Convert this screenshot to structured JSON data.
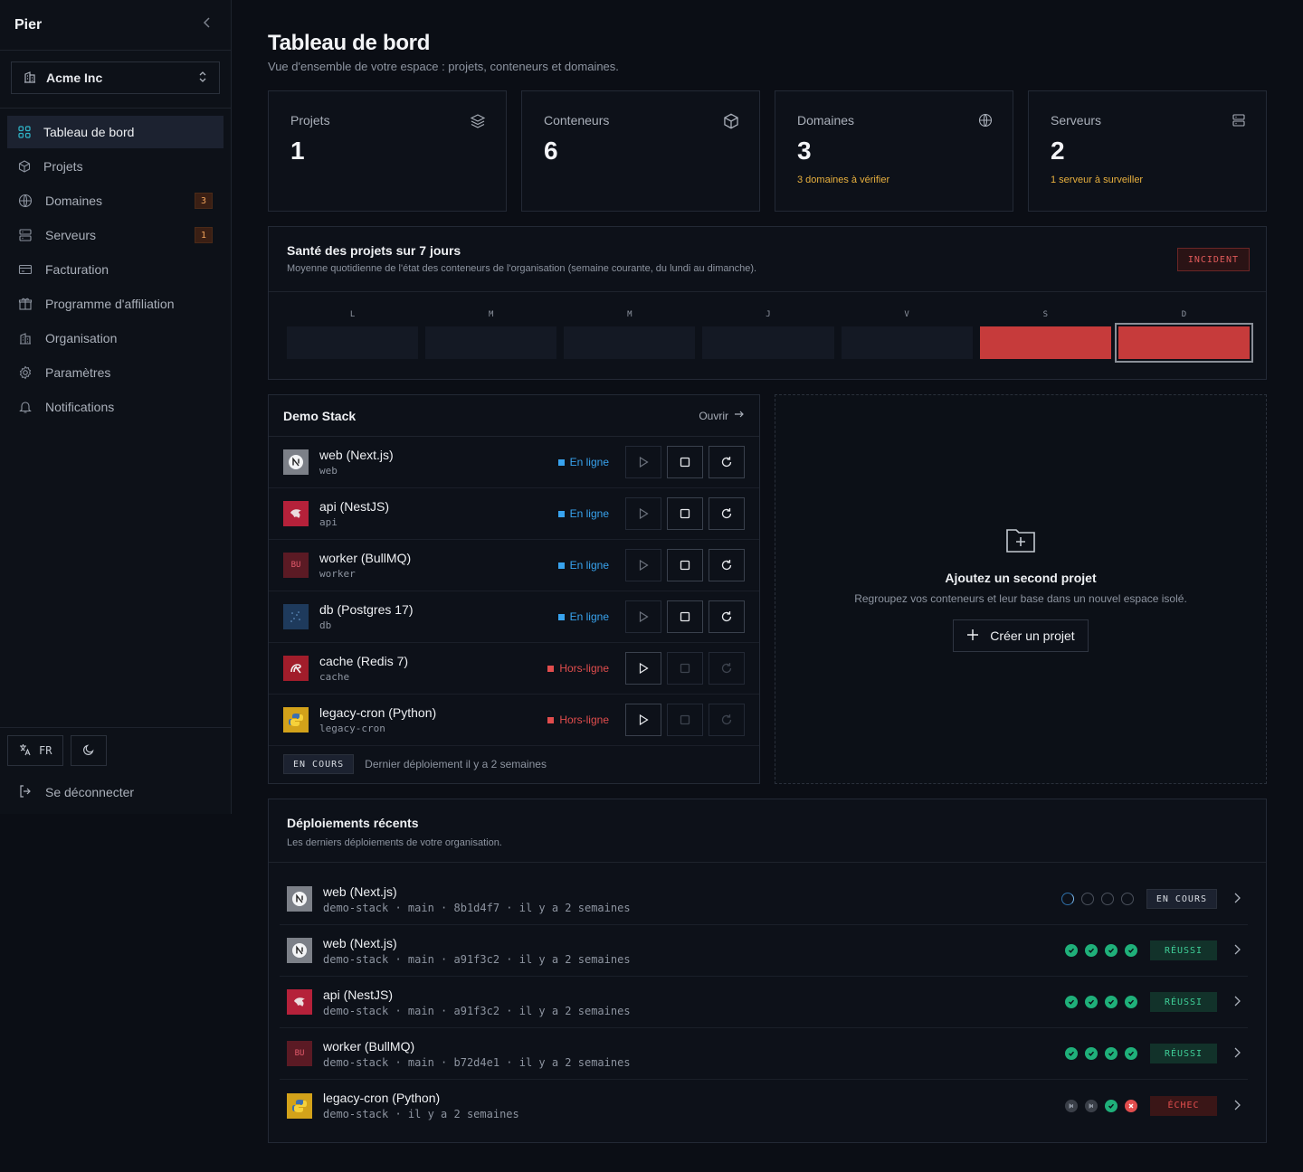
{
  "app": {
    "brand": "Pier"
  },
  "org": {
    "name": "Acme Inc"
  },
  "nav": {
    "items": [
      {
        "label": "Tableau de bord",
        "icon": "grid-icon",
        "active": true,
        "badge": ""
      },
      {
        "label": "Projets",
        "icon": "box-icon",
        "badge": ""
      },
      {
        "label": "Domaines",
        "icon": "globe-icon",
        "badge": "3"
      },
      {
        "label": "Serveurs",
        "icon": "server-icon",
        "badge": "1"
      },
      {
        "label": "Facturation",
        "icon": "card-icon",
        "badge": ""
      },
      {
        "label": "Programme d'affiliation",
        "icon": "gift-icon",
        "badge": ""
      },
      {
        "label": "Organisation",
        "icon": "building-icon",
        "badge": ""
      },
      {
        "label": "Paramètres",
        "icon": "gear-icon",
        "badge": ""
      },
      {
        "label": "Notifications",
        "icon": "bell-icon",
        "badge": ""
      }
    ]
  },
  "footer": {
    "lang": "FR",
    "logout": "Se déconnecter"
  },
  "page": {
    "title": "Tableau de bord",
    "subtitle": "Vue d'ensemble de votre espace : projets, conteneurs et domaines."
  },
  "stats": [
    {
      "label": "Projets",
      "value": "1",
      "note": "",
      "icon": "layers-icon"
    },
    {
      "label": "Conteneurs",
      "value": "6",
      "note": "",
      "icon": "cube-icon"
    },
    {
      "label": "Domaines",
      "value": "3",
      "note": "3 domaines à vérifier",
      "icon": "globe-icon"
    },
    {
      "label": "Serveurs",
      "value": "2",
      "note": "1 serveur à surveiller",
      "icon": "server-icon"
    }
  ],
  "health": {
    "title": "Santé des projets sur 7 jours",
    "subtitle": "Moyenne quotidienne de l'état des conteneurs de l'organisation (semaine courante, du lundi au dimanche).",
    "badge": "INCIDENT",
    "days": [
      {
        "label": "L",
        "state": "none"
      },
      {
        "label": "M",
        "state": "none"
      },
      {
        "label": "M",
        "state": "none"
      },
      {
        "label": "J",
        "state": "none"
      },
      {
        "label": "V",
        "state": "none"
      },
      {
        "label": "S",
        "state": "incident"
      },
      {
        "label": "D",
        "state": "incident",
        "selected": true
      }
    ]
  },
  "stack": {
    "title": "Demo Stack",
    "open_label": "Ouvrir",
    "services": [
      {
        "name": "web (Next.js)",
        "id": "web",
        "status": "En ligne",
        "online": true,
        "logo": "nextjs-logo",
        "logo_text": "N",
        "logo_bg": "#7c8088"
      },
      {
        "name": "api (NestJS)",
        "id": "api",
        "status": "En ligne",
        "online": true,
        "logo": "nestjs-logo",
        "logo_text": "",
        "logo_bg": "#b5213a"
      },
      {
        "name": "worker (BullMQ)",
        "id": "worker",
        "status": "En ligne",
        "online": true,
        "logo": "bullmq-logo",
        "logo_text": "BU",
        "logo_bg": "#5b1a24"
      },
      {
        "name": "db (Postgres 17)",
        "id": "db",
        "status": "En ligne",
        "online": true,
        "logo": "postgres-logo",
        "logo_text": "",
        "logo_bg": "#1e3a5c"
      },
      {
        "name": "cache (Redis 7)",
        "id": "cache",
        "status": "Hors-ligne",
        "online": false,
        "logo": "redis-logo",
        "logo_text": "",
        "logo_bg": "#a11d2b"
      },
      {
        "name": "legacy-cron (Python)",
        "id": "legacy-cron",
        "status": "Hors-ligne",
        "online": false,
        "logo": "python-logo",
        "logo_text": "",
        "logo_bg": "#d3a21a"
      }
    ],
    "footer_tag": "EN COURS",
    "footer_text": "Dernier déploiement il y a 2 semaines"
  },
  "empty": {
    "title": "Ajoutez un second projet",
    "subtitle": "Regroupez vos conteneurs et leur base dans un nouvel espace isolé.",
    "button": "Créer un projet"
  },
  "deploys": {
    "title": "Déploiements récents",
    "subtitle": "Les derniers déploiements de votre organisation.",
    "rows": [
      {
        "name": "web (Next.js)",
        "meta": "demo-stack · main · 8b1d4f7 · il y a 2 semaines",
        "steps": [
          "run",
          "pend",
          "pend",
          "pend"
        ],
        "status": "EN COURS",
        "kind": "running",
        "logo": "nextjs-logo",
        "logo_text": "N",
        "logo_bg": "#7c8088"
      },
      {
        "name": "web (Next.js)",
        "meta": "demo-stack · main · a91f3c2 · il y a 2 semaines",
        "steps": [
          "ok",
          "ok",
          "ok",
          "ok"
        ],
        "status": "RÉUSSI",
        "kind": "success",
        "logo": "nextjs-logo",
        "logo_text": "N",
        "logo_bg": "#7c8088"
      },
      {
        "name": "api (NestJS)",
        "meta": "demo-stack · main · a91f3c2 · il y a 2 semaines",
        "steps": [
          "ok",
          "ok",
          "ok",
          "ok"
        ],
        "status": "RÉUSSI",
        "kind": "success",
        "logo": "nestjs-logo",
        "logo_text": "",
        "logo_bg": "#b5213a"
      },
      {
        "name": "worker (BullMQ)",
        "meta": "demo-stack · main · b72d4e1 · il y a 2 semaines",
        "steps": [
          "ok",
          "ok",
          "ok",
          "ok"
        ],
        "status": "RÉUSSI",
        "kind": "success",
        "logo": "bullmq-logo",
        "logo_text": "BU",
        "logo_bg": "#5b1a24"
      },
      {
        "name": "legacy-cron (Python)",
        "meta": "demo-stack · il y a 2 semaines",
        "steps": [
          "skip",
          "skip",
          "ok",
          "fail"
        ],
        "status": "ÉCHEC",
        "kind": "failure",
        "logo": "python-logo",
        "logo_text": "",
        "logo_bg": "#d3a21a"
      }
    ]
  }
}
